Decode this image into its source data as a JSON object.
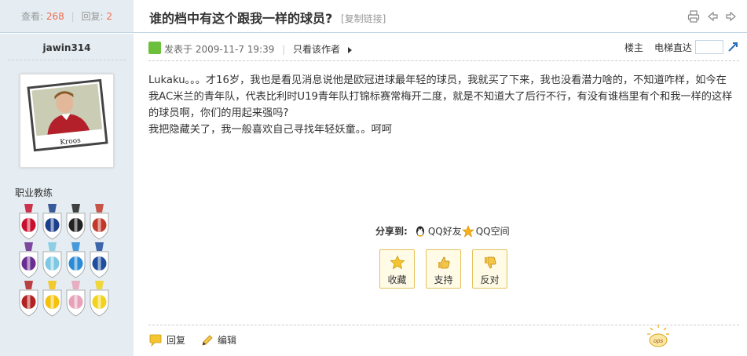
{
  "stats": {
    "views_label": "查看:",
    "views": "268",
    "replies_label": "回复:",
    "replies": "2"
  },
  "thread": {
    "title": "谁的档中有这个跟我一样的球员?",
    "copy_link": "[复制链接]"
  },
  "author": {
    "name": "jawin314",
    "avatar_caption": "Kroos",
    "group": "职业教练"
  },
  "medals": [
    {
      "icon": "ac-milan-medal-icon",
      "color": "#c8102e"
    },
    {
      "icon": "inter-milan-medal-icon",
      "color": "#1b3f8b"
    },
    {
      "icon": "juventus-medal-icon",
      "color": "#222222"
    },
    {
      "icon": "roma-medal-icon",
      "color": "#c0392b"
    },
    {
      "icon": "fiorentina-medal-icon",
      "color": "#6a2c91"
    },
    {
      "icon": "lazio-medal-icon",
      "color": "#7ec8e3"
    },
    {
      "icon": "napoli-medal-icon",
      "color": "#2a8bd6"
    },
    {
      "icon": "sampdoria-medal-icon",
      "color": "#1f4e9c"
    },
    {
      "icon": "genoa-medal-icon",
      "color": "#b22222"
    },
    {
      "icon": "chievo-medal-icon",
      "color": "#f4c20d"
    },
    {
      "icon": "palermo-medal-icon",
      "color": "#e7a1b8"
    },
    {
      "icon": "parma-medal-icon",
      "color": "#f2d21b"
    }
  ],
  "post": {
    "posted_prefix": "发表于",
    "posted_time": "2009-11-7 19:39",
    "only_author": "只看该作者",
    "landlord": "楼主",
    "elevator": "电梯直达",
    "elevator_value": "",
    "paragraphs": [
      "Lukaku。。。才16岁，我也是看见消息说他是欧冠进球最年轻的球员，我就买了下来，我也没看潜力啥的，不知道咋样，如今在我AC米兰的青年队，代表比利时U19青年队打锦标赛常梅开二度，就是不知道大了后行不行，有没有谁档里有个和我一样的这样的球员啊，你们的用起来强吗?",
      "我把隐藏关了，我一般喜欢自己寻找年轻妖童。。呵呵"
    ]
  },
  "share": {
    "label": "分享到:",
    "qq_friend": "QQ好友",
    "qq_zone": "QQ空间"
  },
  "actions": {
    "favorite": "收藏",
    "support": "支持",
    "oppose": "反对"
  },
  "footer": {
    "reply": "回复",
    "edit": "编辑"
  }
}
